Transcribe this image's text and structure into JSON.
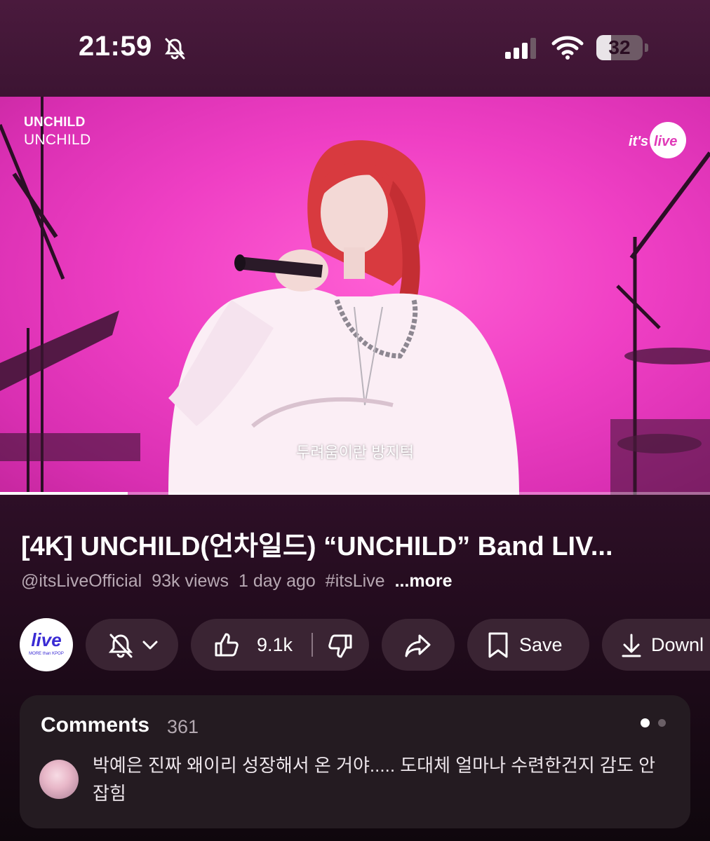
{
  "status_bar": {
    "time": "21:59",
    "battery": "32",
    "battery_level_percent": 32,
    "icons": [
      "bell-off-icon",
      "signal-icon",
      "wifi-icon",
      "battery-icon"
    ]
  },
  "video": {
    "overlay_title_bold": "UNCHILD",
    "overlay_title": "UNCHILD",
    "logo_text": "it's live",
    "subtitle": "두려움이란 방지턱",
    "progress_fraction": 0.18
  },
  "title": "[4K] UNCHILD(언차일드) “UNCHILD” Band LIV...",
  "meta": {
    "channel": "@itsLiveOfficial",
    "views": "93k views",
    "age": "1 day ago",
    "hashtag": "#itsLive",
    "more": "...more"
  },
  "channel_avatar": {
    "logo_text": "live",
    "tagline": "MORE than KPOP"
  },
  "actions": {
    "likes": "9.1k",
    "save": "Save",
    "download": "Downl"
  },
  "comments": {
    "title": "Comments",
    "count": "361",
    "top_comment": "박예은 진짜 왜이리 성장해서 온 거야..... 도대체 얼마나 수련한건지 감도 안 잡힘"
  }
}
